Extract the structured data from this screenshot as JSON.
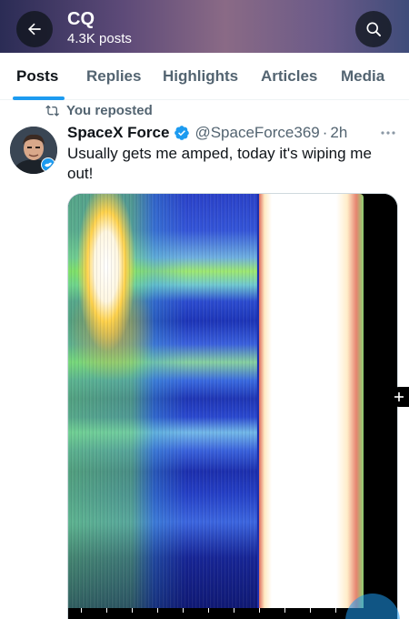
{
  "header": {
    "title": "CQ",
    "subtitle": "4.3K posts",
    "back_icon": "arrow-left-icon",
    "search_icon": "search-icon",
    "gradient_colors": [
      "#2b2c55",
      "#8a6a86",
      "#3f4c7a"
    ]
  },
  "tabs": [
    {
      "label": "Posts",
      "active": true
    },
    {
      "label": "Replies",
      "active": false
    },
    {
      "label": "Highlights",
      "active": false
    },
    {
      "label": "Articles",
      "active": false
    },
    {
      "label": "Media",
      "active": false
    }
  ],
  "accent_color": "#1d9bf0",
  "post": {
    "repost_label": "You reposted",
    "author_name": "SpaceX Force",
    "verified": true,
    "handle": "@SpaceForce369",
    "separator": "·",
    "time": "2h",
    "text": "Usually gets me amped, today it's wiping me out!",
    "media": {
      "type": "spectrogram-image",
      "colors": [
        "#2a41c8",
        "#9de870",
        "#ffd24a",
        "#d23c28",
        "#ffffff"
      ]
    }
  }
}
